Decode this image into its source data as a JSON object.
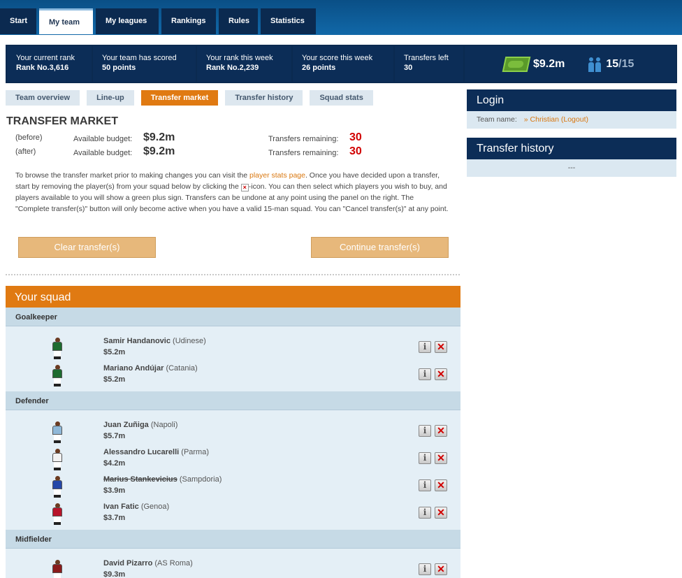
{
  "nav": {
    "tabs": [
      "Start",
      "My team",
      "My leagues",
      "Rankings",
      "Rules",
      "Statistics"
    ],
    "active": "My team"
  },
  "stats": {
    "current_rank_label": "Your current rank",
    "current_rank_value": "Rank No.3,616",
    "scored_label": "Your team has scored",
    "scored_value": "50 points",
    "week_rank_label": "Your rank this week",
    "week_rank_value": "Rank No.2,239",
    "week_score_label": "Your score this week",
    "week_score_value": "26 points",
    "transfers_label": "Transfers left",
    "transfers_value": "30",
    "budget": "$9.2m",
    "squad_count": "15",
    "squad_max": "/15"
  },
  "subtabs": {
    "items": [
      "Team overview",
      "Line-up",
      "Transfer market",
      "Transfer history",
      "Squad stats"
    ],
    "active": "Transfer market"
  },
  "market": {
    "title": "TRANSFER MARKET",
    "before": {
      "tag": "(before)",
      "avail_label": "Available budget:",
      "amount": "$9.2m",
      "rem_label": "Transfers remaining:",
      "remaining": "30"
    },
    "after": {
      "tag": "(after)",
      "avail_label": "Available budget:",
      "amount": "$9.2m",
      "rem_label": "Transfers remaining:",
      "remaining": "30"
    },
    "info_1": "To browse the transfer market prior to making changes you can visit the ",
    "info_link": "player stats page",
    "info_2": ". Once you have decided upon a transfer, start by removing the player(s) from your squad below by clicking the ",
    "info_3": "-icon. You can then select which players you wish to buy, and players available to you will show a green plus sign. Transfers can be undone at any point using the panel on the right. The \"Complete transfer(s)\" button will only become active when you have a valid 15-man squad. You can \"Cancel transfer(s)\" at any point.",
    "clear_button": "Clear transfer(s)",
    "continue_button": "Continue transfer(s)"
  },
  "squad": {
    "title": "Your squad",
    "groups": {
      "gk": "Goalkeeper",
      "def": "Defender",
      "mid": "Midfielder"
    },
    "players": [
      {
        "name": "Samir Handanovic",
        "club": "(Udinese)",
        "price": "$5.2m",
        "shirt": "#1d6b2f"
      },
      {
        "name": "Mariano Andújar",
        "club": "(Catania)",
        "price": "$5.2m",
        "shirt": "#1d6b2f"
      },
      {
        "name": "Juan Zuñiga",
        "club": "(Napoli)",
        "price": "$5.7m",
        "shirt": "#8fb8d8"
      },
      {
        "name": "Alessandro Lucarelli",
        "club": "(Parma)",
        "price": "$4.2m",
        "shirt": "#f2f2f2"
      },
      {
        "name": "Marius Stankevicius",
        "club": "(Sampdoria)",
        "price": "$3.9m",
        "shirt": "#2447a8"
      },
      {
        "name": "Ivan Fatic",
        "club": "(Genoa)",
        "price": "$3.7m",
        "shirt": "#b8142a"
      },
      {
        "name": "David Pizarro",
        "club": "(AS Roma)",
        "price": "$9.3m",
        "shirt": "#8a1b1b"
      }
    ]
  },
  "login": {
    "title": "Login",
    "team_label": "Team name:",
    "team_value": "» Christian (Logout)"
  },
  "history": {
    "title": "Transfer history",
    "empty": "---"
  },
  "colors": {
    "accent_orange": "#e07a12",
    "navy": "#0c2d57",
    "red": "#d10000"
  }
}
